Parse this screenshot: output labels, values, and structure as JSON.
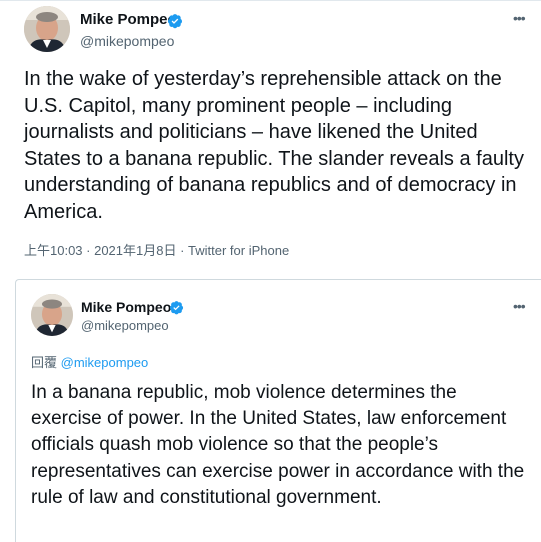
{
  "tweet": {
    "author_name": "Mike Pompeo",
    "author_handle": "@mikepompeo",
    "text": "In the wake of yesterday’s reprehensible attack on the U.S. Capitol, many prominent people – including journalists and politicians – have likened the United States to a banana republic. The slander reveals a faulty understanding of banana republics and of democracy in America.",
    "timestamp": "上午10:03 · 2021年1月8日 · Twitter for iPhone",
    "more_icon": "ellipsis-icon",
    "verified_icon": "verified-badge-icon"
  },
  "reply": {
    "author_name": "Mike Pompeo",
    "author_handle": "@mikepompeo",
    "replying_label": "回覆",
    "replying_to": "@mikepompeo",
    "text": "In a banana republic, mob violence determines the exercise of power.  In the United States, law enforcement officials quash mob violence so that the people’s representatives can exercise power in accordance with the rule of law and constitutional government.",
    "more_icon": "ellipsis-icon"
  },
  "colors": {
    "verified": "#1d9bf0",
    "link": "#1d9bf0",
    "secondary_text": "#536471",
    "primary_text": "#0f1419"
  }
}
